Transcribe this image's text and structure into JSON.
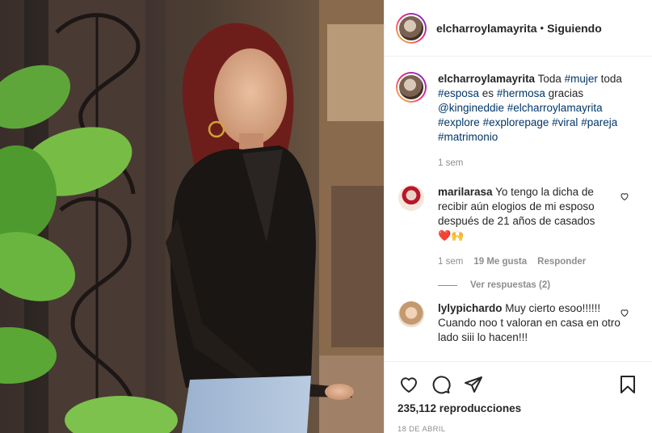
{
  "post": {
    "username": "elcharroylamayrita",
    "dot": "•",
    "follow_status": "Siguiendo"
  },
  "caption": {
    "username": "elcharroylamayrita",
    "parts": {
      "p1": " Toda ",
      "h1": "#mujer",
      "p2": " toda ",
      "h2": "#esposa",
      "p3": " es ",
      "h3": "#hermosa",
      "p4": " gracias ",
      "h4": "@kingineddie",
      "p5": " ",
      "h5": "#elcharroylamayrita",
      "h6": "#explore",
      "h7": "#explorepage",
      "h8": "#viral",
      "h9": "#pareja",
      "h10": "#matrimonio"
    },
    "time": "1 sem"
  },
  "comments": [
    {
      "username": "marilarasa",
      "text": " Yo tengo la dicha de recibir aún elogios de mi esposo después de 21 años de casados",
      "emoji": "❤️🙌",
      "time": "1 sem",
      "likes": "19 Me gusta",
      "reply": "Responder",
      "view_replies": "Ver respuestas (2)"
    },
    {
      "username": "lylypichardo",
      "text": " Muy cierto esoo!!!!!! Cuando noo t valoran en casa en otro lado siii lo hacen!!!"
    }
  ],
  "actions": {
    "icons": [
      "heart-icon",
      "comment-icon",
      "share-icon",
      "bookmark-icon"
    ],
    "views": "235,112 reproducciones",
    "date": "18 DE ABRIL"
  },
  "colors": {
    "hashtag": "#00376b",
    "secondary_text": "#8e8e8e",
    "primary_text": "#262626",
    "heart_red": "#e0162b"
  }
}
